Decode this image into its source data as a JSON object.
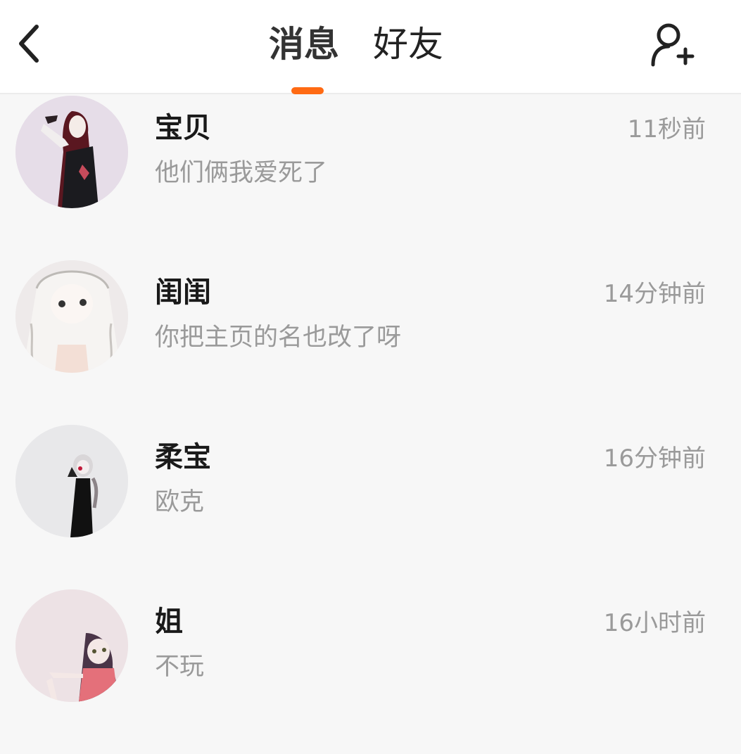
{
  "header": {
    "back_icon": "chevron-left-icon",
    "tabs": [
      {
        "label": "消息",
        "active": true
      },
      {
        "label": "好友",
        "active": false
      }
    ],
    "accent_color": "#ff6a13",
    "add_friend_icon": "user-plus-icon"
  },
  "conversations": [
    {
      "name": "宝贝",
      "preview": "他们俩我爱死了",
      "time": "11秒前",
      "avatar_bg": "#e6dde8"
    },
    {
      "name": "闺闺",
      "preview": "你把主页的名也改了呀",
      "time": "14分钟前",
      "avatar_bg": "#eeeaea"
    },
    {
      "name": "柔宝",
      "preview": "欧克",
      "time": "16分钟前",
      "avatar_bg": "#e8e8ea"
    },
    {
      "name": "姐",
      "preview": "不玩",
      "time": "16小时前",
      "avatar_bg": "#ede2e5"
    }
  ]
}
